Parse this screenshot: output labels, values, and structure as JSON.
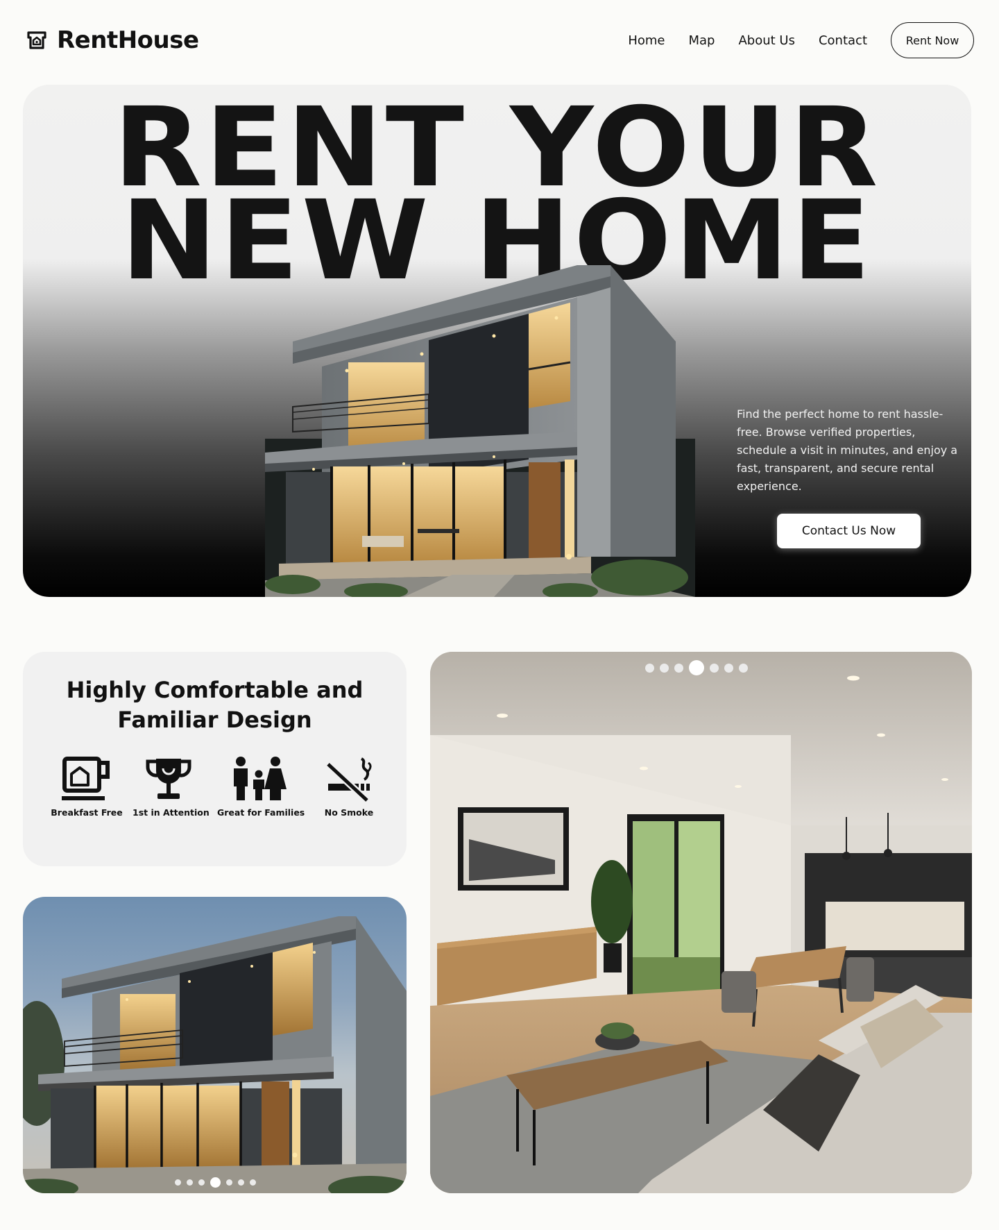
{
  "brand": {
    "name": "RentHouse",
    "icon": "house-logo-icon"
  },
  "nav": {
    "links": [
      "Home",
      "Map",
      "About Us",
      "Contact"
    ],
    "cta": "Rent Now"
  },
  "hero": {
    "title_line1": "RENT YOUR",
    "title_line2": "NEW HOME",
    "description": "Find the perfect home to rent hassle-free. Browse verified properties, schedule a visit in minutes, and enjoy a fast, transparent, and secure rental experience.",
    "cta": "Contact Us Now"
  },
  "features": {
    "title_line1": "Highly Comfortable and",
    "title_line2": "Familiar Design",
    "items": [
      {
        "label": "Breakfast Free",
        "icon": "coffee-cup-icon"
      },
      {
        "label": "1st in Attention",
        "icon": "trophy-icon"
      },
      {
        "label": "Great for Families",
        "icon": "family-icon"
      },
      {
        "label": "No Smoke",
        "icon": "no-smoking-icon"
      }
    ]
  },
  "gallery": {
    "exterior_carousel": {
      "slides": 7,
      "active_index": 3
    },
    "interior_carousel": {
      "slides": 7,
      "active_index": 3
    }
  },
  "colors": {
    "background": "#fbfbf9",
    "text": "#111111",
    "card": "#f1f1f1",
    "warm_light": "#f3c77a"
  }
}
